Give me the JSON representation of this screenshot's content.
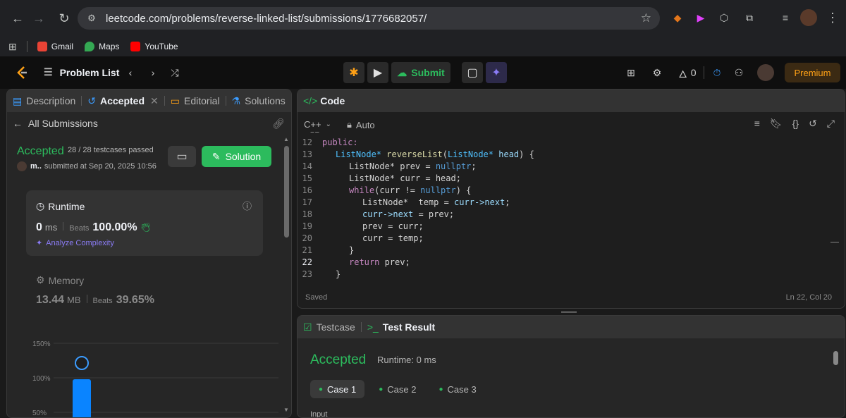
{
  "browser": {
    "url": "leetcode.com/problems/reverse-linked-list/submissions/1776682057/",
    "bookmarks": [
      {
        "label": "Gmail",
        "color": "#ea4335"
      },
      {
        "label": "Maps",
        "color": "#34a853"
      },
      {
        "label": "YouTube",
        "color": "#ff0000"
      }
    ]
  },
  "header": {
    "problem_list": "Problem List",
    "submit": "Submit",
    "fire_count": "0",
    "premium": "Premium"
  },
  "left_panel": {
    "tabs": [
      "Description",
      "Accepted",
      "Editorial",
      "Solutions"
    ],
    "back_label": "All Submissions",
    "status": "Accepted",
    "testcases": "28 / 28 testcases passed",
    "user": "m..",
    "submitted": "submitted at Sep 20, 2025 10:56",
    "solution_button": "Solution",
    "runtime": {
      "title": "Runtime",
      "value": "0",
      "unit": "ms",
      "beats_label": "Beats",
      "beats": "100.00%",
      "analyze": "Analyze Complexity"
    },
    "memory": {
      "title": "Memory",
      "value": "13.44",
      "unit": "MB",
      "beats_label": "Beats",
      "beats": "39.65%"
    },
    "chart_data": {
      "type": "bar",
      "y_ticks": [
        "150%",
        "100%",
        "50%"
      ],
      "values": [
        100
      ],
      "ylim": [
        50,
        150
      ]
    }
  },
  "code_panel": {
    "title": "Code",
    "language": "C++",
    "auto": "Auto",
    "lines": [
      {
        "n": "12",
        "html": "public:"
      },
      {
        "n": "13",
        "html": "ListNode* reverseList(ListNode* head) {"
      },
      {
        "n": "14",
        "html": "ListNode* prev = nullptr;"
      },
      {
        "n": "15",
        "html": "ListNode* curr = head;"
      },
      {
        "n": "16",
        "html": "while(curr != nullptr) {"
      },
      {
        "n": "17",
        "html": "ListNode*  temp = curr->next;"
      },
      {
        "n": "18",
        "html": "curr->next = prev;"
      },
      {
        "n": "19",
        "html": "prev = curr;"
      },
      {
        "n": "20",
        "html": "curr = temp;"
      },
      {
        "n": "21",
        "html": "}"
      },
      {
        "n": "22",
        "html": "return prev;"
      },
      {
        "n": "23",
        "html": "}"
      }
    ],
    "saved": "Saved",
    "cursor": "Ln 22, Col 20"
  },
  "result_panel": {
    "tabs": [
      "Testcase",
      "Test Result"
    ],
    "status": "Accepted",
    "runtime": "Runtime: 0 ms",
    "cases": [
      "Case 1",
      "Case 2",
      "Case 3"
    ],
    "input_label": "Input"
  }
}
